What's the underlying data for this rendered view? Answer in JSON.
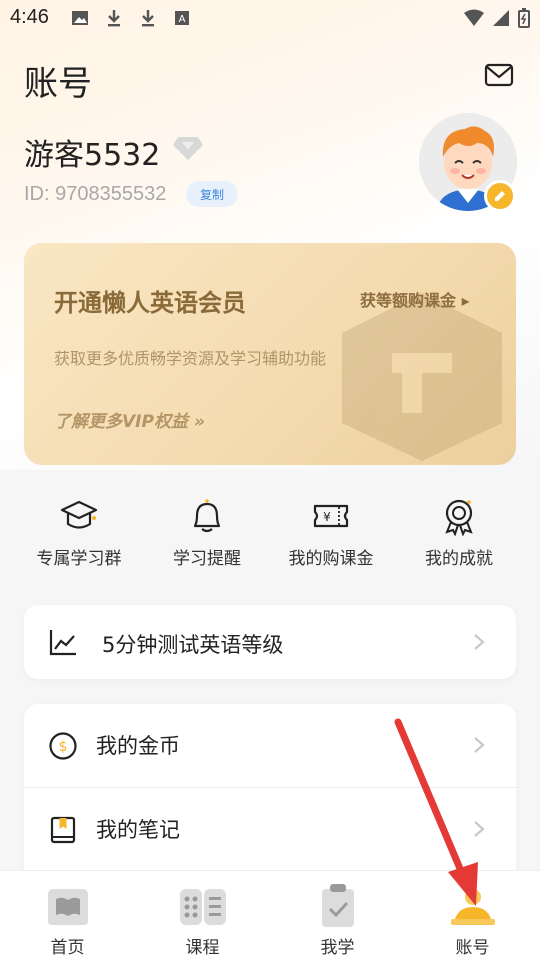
{
  "status_bar": {
    "time": "4:46"
  },
  "header": {
    "title": "账号"
  },
  "profile": {
    "name": "游客5532",
    "id_text": "ID: 9708355532",
    "copy_label": "复制"
  },
  "vip": {
    "title": "开通懒人英语会员",
    "subtitle": "获取更多优质畅学资源及学习辅助功能",
    "link": "了解更多VIP权益 »",
    "right_link": "获等额购课金 ▸"
  },
  "shortcuts": [
    {
      "label": "专属学习群",
      "icon": "graduation-cap-icon"
    },
    {
      "label": "学习提醒",
      "icon": "bell-icon"
    },
    {
      "label": "我的购课金",
      "icon": "ticket-icon"
    },
    {
      "label": "我的成就",
      "icon": "medal-icon"
    }
  ],
  "test_card": {
    "label": "5分钟测试英语等级",
    "icon": "chart-icon"
  },
  "menu": [
    {
      "label": "我的金币",
      "icon": "coin-icon"
    },
    {
      "label": "我的笔记",
      "icon": "notebook-icon"
    }
  ],
  "tabs": [
    {
      "label": "首页",
      "icon": "home-book-icon"
    },
    {
      "label": "课程",
      "icon": "grid-icon"
    },
    {
      "label": "我学",
      "icon": "clipboard-check-icon"
    },
    {
      "label": "账号",
      "icon": "account-icon",
      "active": true
    }
  ],
  "colors": {
    "accent": "#f7b52a",
    "vip_text": "#8a6a39",
    "annotation_arrow": "#e53935"
  }
}
